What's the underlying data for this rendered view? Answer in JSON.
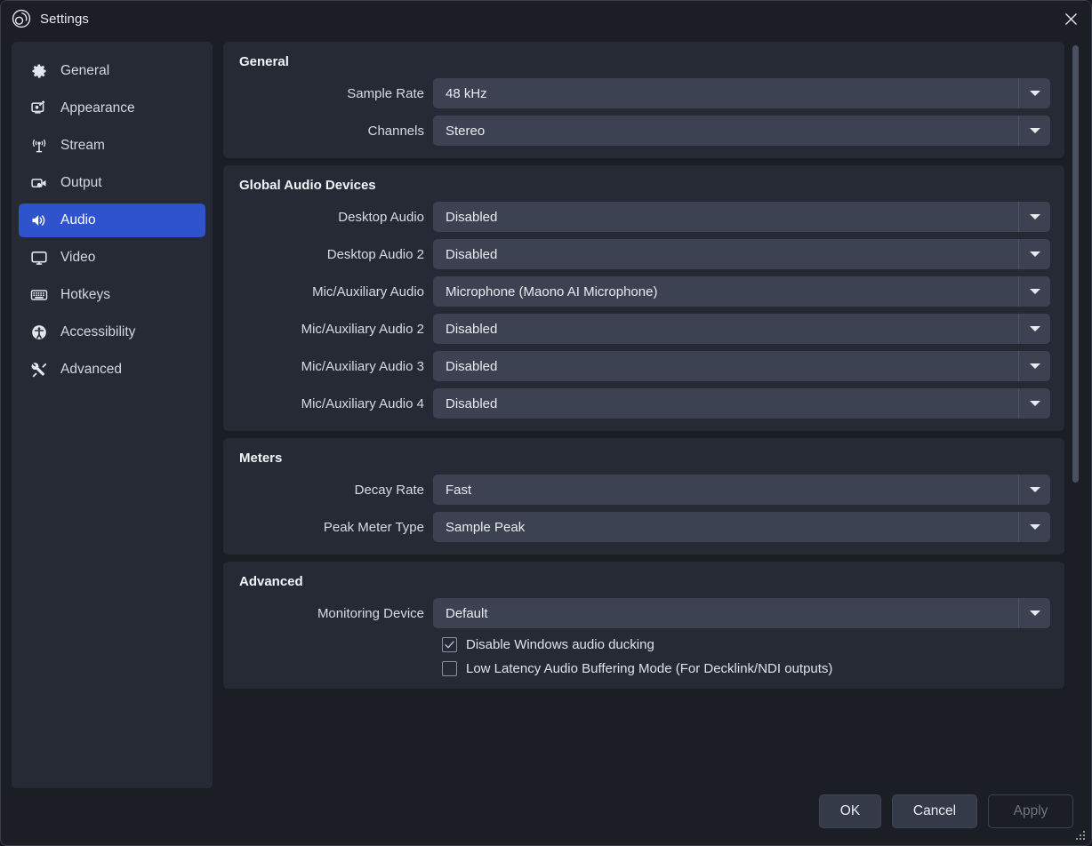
{
  "window": {
    "title": "Settings",
    "logo_icon": "obs-logo-icon",
    "close_icon": "close-icon",
    "accent_color": "#2e53cc",
    "panel_color": "#252a35",
    "background_color": "#1b1e25",
    "field_color": "#3d4252"
  },
  "sidebar": {
    "items": [
      {
        "label": "General",
        "icon": "gear-icon",
        "active": false
      },
      {
        "label": "Appearance",
        "icon": "appearance-icon",
        "active": false
      },
      {
        "label": "Stream",
        "icon": "broadcast-icon",
        "active": false
      },
      {
        "label": "Output",
        "icon": "video-camera-icon",
        "active": false
      },
      {
        "label": "Audio",
        "icon": "speaker-icon",
        "active": true
      },
      {
        "label": "Video",
        "icon": "monitor-icon",
        "active": false
      },
      {
        "label": "Hotkeys",
        "icon": "keyboard-icon",
        "active": false
      },
      {
        "label": "Accessibility",
        "icon": "accessibility-icon",
        "active": false
      },
      {
        "label": "Advanced",
        "icon": "tools-icon",
        "active": false
      }
    ]
  },
  "sections": [
    {
      "title": "General",
      "rows": [
        {
          "label": "Sample Rate",
          "value": "48 kHz"
        },
        {
          "label": "Channels",
          "value": "Stereo"
        }
      ],
      "checkboxes": []
    },
    {
      "title": "Global Audio Devices",
      "rows": [
        {
          "label": "Desktop Audio",
          "value": "Disabled"
        },
        {
          "label": "Desktop Audio 2",
          "value": "Disabled"
        },
        {
          "label": "Mic/Auxiliary Audio",
          "value": "Microphone (Maono AI Microphone)"
        },
        {
          "label": "Mic/Auxiliary Audio 2",
          "value": "Disabled"
        },
        {
          "label": "Mic/Auxiliary Audio 3",
          "value": "Disabled"
        },
        {
          "label": "Mic/Auxiliary Audio 4",
          "value": "Disabled"
        }
      ],
      "checkboxes": []
    },
    {
      "title": "Meters",
      "rows": [
        {
          "label": "Decay Rate",
          "value": "Fast"
        },
        {
          "label": "Peak Meter Type",
          "value": "Sample Peak"
        }
      ],
      "checkboxes": []
    },
    {
      "title": "Advanced",
      "rows": [
        {
          "label": "Monitoring Device",
          "value": "Default"
        }
      ],
      "checkboxes": [
        {
          "label": "Disable Windows audio ducking",
          "checked": true
        },
        {
          "label": "Low Latency Audio Buffering Mode (For Decklink/NDI outputs)",
          "checked": false
        }
      ]
    }
  ],
  "footer": {
    "ok_label": "OK",
    "cancel_label": "Cancel",
    "apply_label": "Apply",
    "apply_disabled": true
  }
}
